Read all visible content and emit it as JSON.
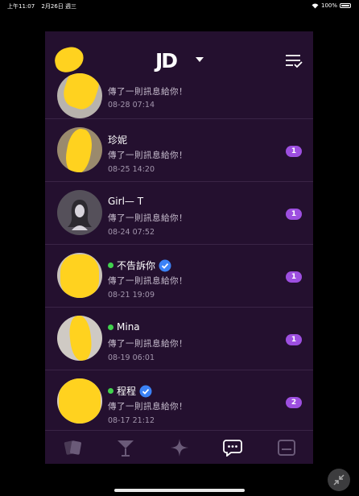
{
  "status_bar": {
    "time": "上午11:07",
    "date": "2月26日 週三",
    "battery": "100%"
  },
  "header": {
    "logo": "JD"
  },
  "conversations": [
    {
      "name": "",
      "online": false,
      "verified": false,
      "message": "傳了一則訊息給你！",
      "time": "08-28  07:14",
      "unread": ""
    },
    {
      "name": "珍妮",
      "online": false,
      "verified": false,
      "message": "傳了一則訊息給你！",
      "time": "08-25  14:20",
      "unread": "1"
    },
    {
      "name": "Girl— T",
      "online": false,
      "verified": false,
      "message": "傳了一則訊息給你！",
      "time": "08-24  07:52",
      "unread": "1"
    },
    {
      "name": "不告訴你",
      "online": true,
      "verified": true,
      "message": "傳了一則訊息給你！",
      "time": "08-21  19:09",
      "unread": "1"
    },
    {
      "name": "Mina",
      "online": true,
      "verified": false,
      "message": "傳了一則訊息給你！",
      "time": "08-19  06:01",
      "unread": "1"
    },
    {
      "name": "程程",
      "online": true,
      "verified": true,
      "message": "傳了一則訊息給你！",
      "time": "08-17  21:12",
      "unread": "2"
    }
  ],
  "tabs": [
    {
      "icon": "cards-icon"
    },
    {
      "icon": "cocktail-icon"
    },
    {
      "icon": "sparkle-icon"
    },
    {
      "icon": "chat-bubble-icon",
      "active": true
    },
    {
      "icon": "profile-card-icon"
    }
  ],
  "colors": {
    "background": "#24102f",
    "badge": "#9d4fe0",
    "online": "#41d24e",
    "verified": "#3b82f6"
  }
}
